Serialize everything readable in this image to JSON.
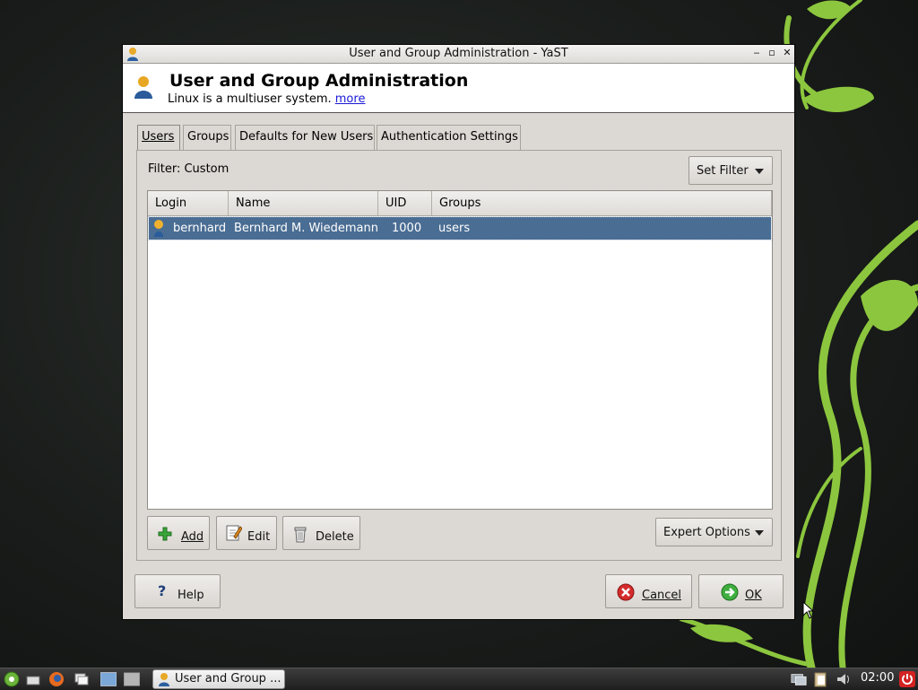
{
  "window": {
    "title": "User and Group Administration - YaST",
    "minimize_glyph": "‒",
    "maximize_glyph": "▫",
    "close_glyph": "✕"
  },
  "header": {
    "title": "User and Group Administration",
    "subtitle": "Linux is a multiuser system.",
    "more_link": "more"
  },
  "tabs": [
    {
      "label": "Users",
      "active": true
    },
    {
      "label": "Groups",
      "active": false
    },
    {
      "label": "Defaults for New Users",
      "active": false
    },
    {
      "label": "Authentication Settings",
      "active": false
    }
  ],
  "filter": {
    "label": "Filter: Custom",
    "set_filter_button": "Set Filter"
  },
  "table": {
    "columns": [
      "Login",
      "Name",
      "UID",
      "Groups"
    ],
    "rows": [
      {
        "login": "bernhard",
        "name": "Bernhard M. Wiedemann",
        "uid": "1000",
        "groups": "users",
        "selected": true
      }
    ]
  },
  "actions": {
    "add": "Add",
    "edit": "Edit",
    "delete": "Delete",
    "expert_options": "Expert Options"
  },
  "footer": {
    "help": "Help",
    "cancel": "Cancel",
    "ok": "OK"
  },
  "taskbar": {
    "task_label": "User and Group ...",
    "clock": "02:00"
  },
  "colors": {
    "selection": "#4a6d93",
    "accent_green": "#8cc63e",
    "desktop_bg": "#1a1d1b"
  }
}
